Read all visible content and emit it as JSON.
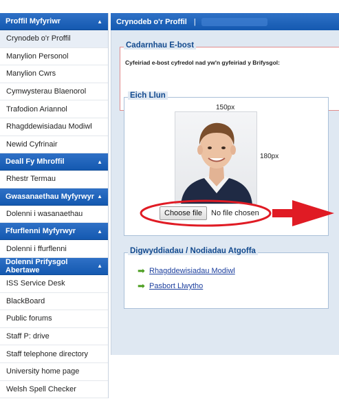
{
  "sidebar": {
    "sections": [
      {
        "title": "Proffil Myfyriwr",
        "items": [
          "Crynodeb o'r Proffil",
          "Manylion Personol",
          "Manylion Cwrs",
          "Cymwysterau Blaenorol",
          "Trafodion Ariannol",
          "Rhagddewisiadau Modiwl",
          "Newid Cyfrinair"
        ]
      },
      {
        "title": "Deall Fy Mhroffil",
        "items": [
          "Rhestr Termau"
        ]
      },
      {
        "title": "Gwasanaethau Myfyrwyr",
        "items": [
          "Dolenni i wasanaethau"
        ]
      },
      {
        "title": "Ffurflenni Myfyrwyr",
        "items": [
          "Dolenni i ffurflenni"
        ]
      },
      {
        "title": "Dolenni Prifysgol Abertawe",
        "items": [
          "ISS Service Desk",
          "BlackBoard",
          "Public forums",
          "Staff P: drive",
          "Staff telephone directory",
          "University home page",
          "Welsh Spell Checker"
        ]
      }
    ]
  },
  "header": {
    "title": "Crynodeb o'r Proffil",
    "separator": "|"
  },
  "email_panel": {
    "legend": "Cadarnhau E-bost",
    "message": "Cyfeiriad e-bost cyfredol nad yw'n gyfeiriad y Brifysgol:"
  },
  "photo_panel": {
    "legend": "Eich Llun",
    "width_label": "150px",
    "height_label": "180px",
    "file_button": "Choose file",
    "file_status": "No file chosen"
  },
  "events_panel": {
    "legend": "Digwyddiadau / Nodiadau Atgoffa",
    "links": [
      "Rhagddewisiadau Modiwl",
      "Pasbort Llwytho"
    ]
  },
  "colors": {
    "header_blue": "#1a5fb4",
    "annotation_red": "#e01b24",
    "link_green_arrow": "#4a9d1e"
  }
}
